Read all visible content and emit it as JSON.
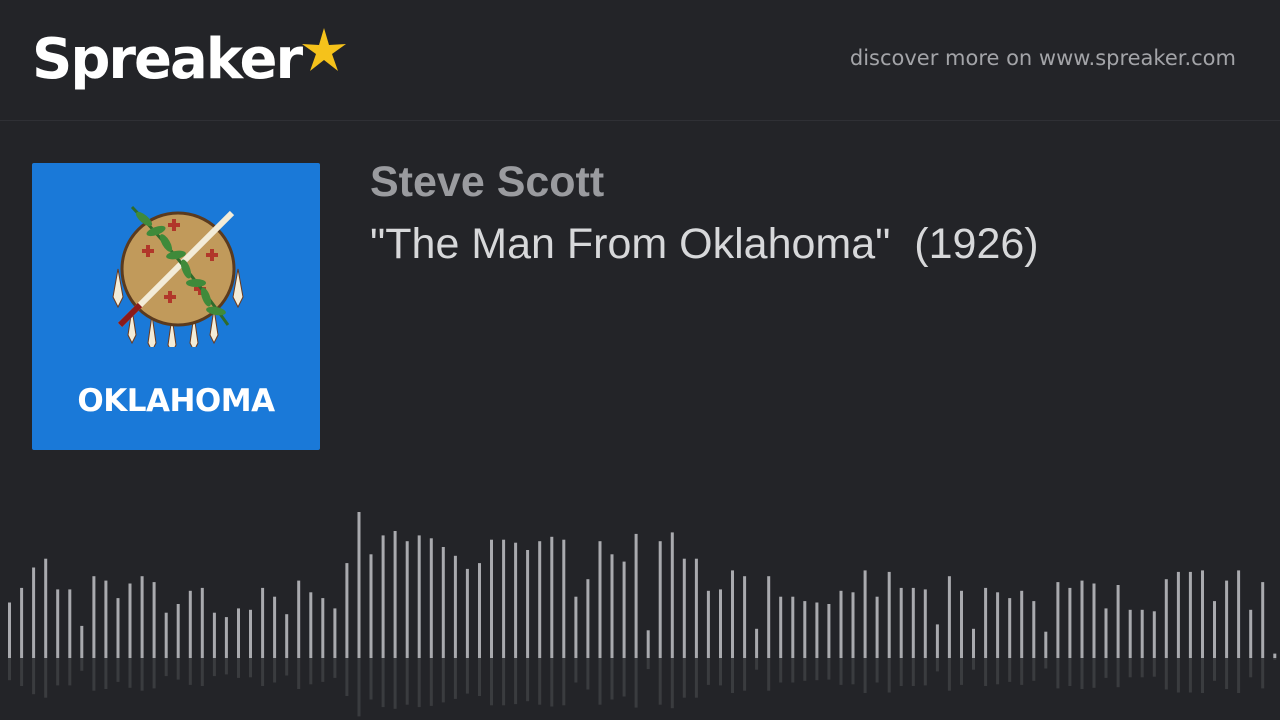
{
  "header": {
    "logo_text": "Spreaker",
    "logo_star_color": "#f5c21b",
    "discover_text": "discover more on www.spreaker.com"
  },
  "episode": {
    "author": "Steve Scott",
    "title": "\"The Man From Oklahoma\"  (1926)",
    "cover_label": "OKLAHOMA",
    "cover_bg": "#1a79d8"
  },
  "waveform": {
    "bar_color": "#a9aaae",
    "levels": [
      0.38,
      0.48,
      0.62,
      0.68,
      0.47,
      0.47,
      0.22,
      0.56,
      0.53,
      0.41,
      0.51,
      0.56,
      0.52,
      0.31,
      0.37,
      0.46,
      0.48,
      0.31,
      0.28,
      0.34,
      0.33,
      0.48,
      0.42,
      0.3,
      0.53,
      0.45,
      0.41,
      0.34,
      0.65,
      1.0,
      0.71,
      0.84,
      0.87,
      0.8,
      0.84,
      0.82,
      0.76,
      0.7,
      0.61,
      0.65,
      0.81,
      0.81,
      0.79,
      0.74,
      0.8,
      0.83,
      0.81,
      0.42,
      0.54,
      0.8,
      0.71,
      0.66,
      0.85,
      0.19,
      0.8,
      0.86,
      0.68,
      0.68,
      0.46,
      0.47,
      0.6,
      0.56,
      0.2,
      0.56,
      0.42,
      0.42,
      0.39,
      0.38,
      0.37,
      0.46,
      0.45,
      0.6,
      0.42,
      0.59,
      0.48,
      0.48,
      0.47,
      0.23,
      0.56,
      0.46,
      0.2,
      0.48,
      0.45,
      0.41,
      0.46,
      0.39,
      0.18,
      0.52,
      0.48,
      0.53,
      0.51,
      0.34,
      0.5,
      0.33,
      0.33,
      0.32,
      0.54,
      0.59,
      0.59,
      0.6,
      0.39,
      0.53,
      0.6,
      0.33,
      0.52,
      0.03
    ]
  }
}
